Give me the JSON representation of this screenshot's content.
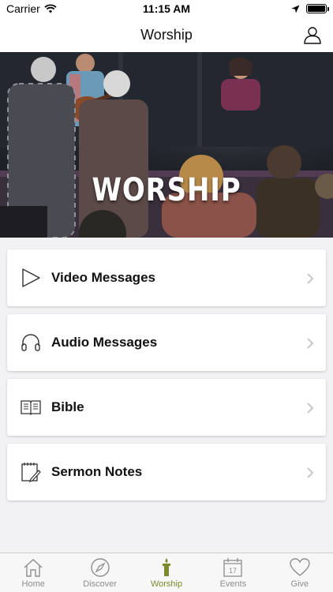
{
  "status_bar": {
    "carrier": "Carrier",
    "time": "11:15 AM",
    "battery_level": 1.0
  },
  "nav": {
    "title": "Worship"
  },
  "hero": {
    "title": "WORSHIP"
  },
  "cards": [
    {
      "label": "Video Messages",
      "icon": "play-icon"
    },
    {
      "label": "Audio Messages",
      "icon": "headphones-icon"
    },
    {
      "label": "Bible",
      "icon": "book-icon"
    },
    {
      "label": "Sermon Notes",
      "icon": "notes-icon"
    }
  ],
  "tabs": [
    {
      "label": "Home",
      "icon": "home-icon",
      "active": false
    },
    {
      "label": "Discover",
      "icon": "compass-icon",
      "active": false
    },
    {
      "label": "Worship",
      "icon": "candle-icon",
      "active": true
    },
    {
      "label": "Events",
      "icon": "calendar-icon",
      "active": false
    },
    {
      "label": "Give",
      "icon": "heart-icon",
      "active": false
    }
  ],
  "colors": {
    "accent": "#7c8a2d",
    "inactive": "#8e8e8e",
    "background": "#f2f2f4"
  },
  "calendar_day": "17"
}
